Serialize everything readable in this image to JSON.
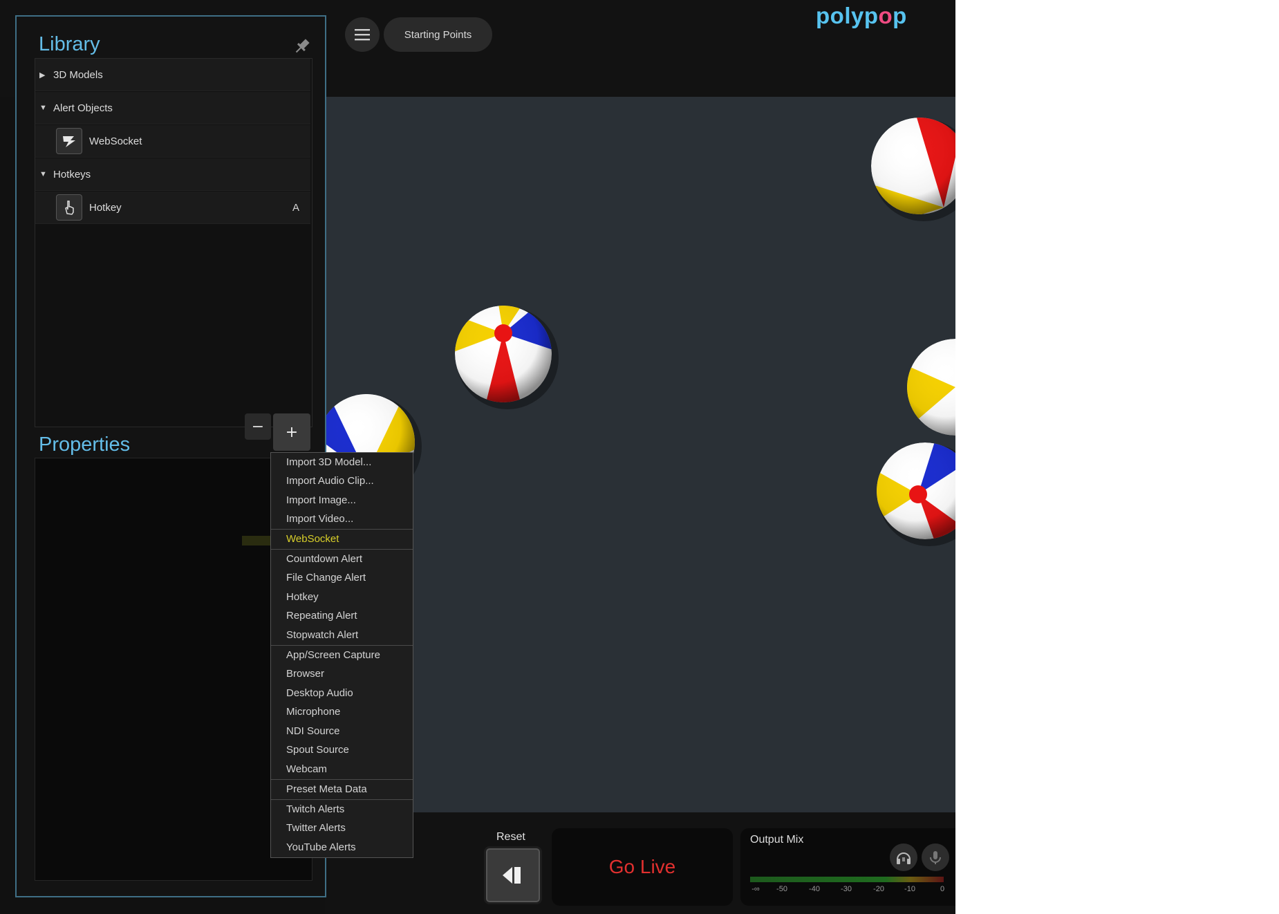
{
  "topbar": {
    "starting_points_label": "Starting Points",
    "logo_text_a": "polyp",
    "logo_text_b": "o",
    "logo_text_c": "p"
  },
  "library": {
    "title": "Library",
    "groups": [
      {
        "label": "3D Models",
        "expanded": false
      },
      {
        "label": "Alert Objects",
        "expanded": true,
        "children": [
          {
            "label": "WebSocket",
            "icon": "websocket-icon"
          }
        ]
      },
      {
        "label": "Hotkeys",
        "expanded": true,
        "children": [
          {
            "label": "Hotkey",
            "icon": "hand-pointer-icon",
            "key": "A"
          }
        ]
      }
    ],
    "minus_label": "−",
    "plus_label": "+"
  },
  "properties": {
    "title": "Properties"
  },
  "dropdown": {
    "items": [
      "Import 3D Model...",
      "Import Audio Clip...",
      "Import Image...",
      "Import Video...",
      "WebSocket",
      "Countdown Alert",
      "File Change Alert",
      "Hotkey",
      "Repeating Alert",
      "Stopwatch Alert",
      "App/Screen Capture",
      "Browser",
      "Desktop Audio",
      "Microphone",
      "NDI Source",
      "Spout Source",
      "Webcam",
      "Preset Meta Data",
      "Twitch Alerts",
      "Twitter Alerts",
      "YouTube Alerts"
    ],
    "highlighted": "WebSocket"
  },
  "bottombar": {
    "reset_label": "Reset",
    "go_live_label": "Go Live",
    "output_mix_label": "Output Mix",
    "meter_ticks": [
      "-∞",
      "-50",
      "-40",
      "-30",
      "-20",
      "-10",
      "0"
    ]
  },
  "colors": {
    "accent": "#64bde8",
    "go_live": "#e2302f",
    "highlight": "#d8cf2a",
    "stage": "#2a3036"
  }
}
